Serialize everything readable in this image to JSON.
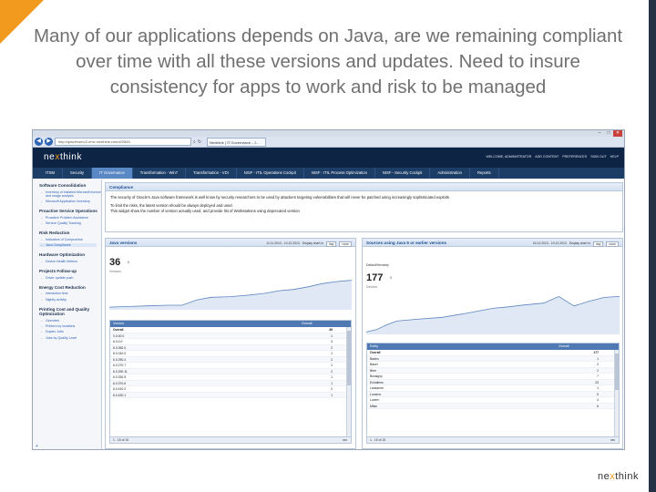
{
  "slide": {
    "title": "Many of our applications depends on Java, are we remaining compliant over time with all these versions and updates. Need to insure consistency for apps to work and risk to be managed",
    "brand_pre": "ne",
    "brand_x": "x",
    "brand_post": "think",
    "accent_color": "#f29a1d",
    "dark_color": "#253246"
  },
  "browser": {
    "url": "http://qaw.fixserv2.emc.nexthink.com/#/2845",
    "tab": "Nexthink | IT Governance - J...",
    "back_icon": "back-arrow-icon",
    "forward_icon": "forward-arrow-icon"
  },
  "app": {
    "logo_pre": "ne",
    "logo_x": "x",
    "logo_post": "think",
    "user_links": [
      "WELCOME, ADMINISTRATOR",
      "ADD CONTENT",
      "PREFERENCES",
      "SIGN OUT",
      "HELP"
    ],
    "tabs": [
      {
        "label": "ITSM",
        "active": false
      },
      {
        "label": "Security",
        "active": false
      },
      {
        "label": "IT Governance",
        "active": true
      },
      {
        "label": "Transformation - Win7",
        "active": false
      },
      {
        "label": "Transformation - VDI",
        "active": false
      },
      {
        "label": "NISF - ITIL Operations Cockpit",
        "active": false
      },
      {
        "label": "NISF - ITIL Process Optimization",
        "active": false
      },
      {
        "label": "NISF - Security Cockpit",
        "active": false
      },
      {
        "label": "Administration",
        "active": false
      },
      {
        "label": "Reports",
        "active": false
      }
    ]
  },
  "sidebar": {
    "groups": [
      {
        "title": "Software Consolidation",
        "items": [
          "Inventory of installed Microsoft licence and usage analysis",
          "Microsoft Application Inventory"
        ]
      },
      {
        "title": "Proactive Service Operations",
        "items": [
          "Proactive Problem Avoidance",
          "Service Quality Tracking"
        ]
      },
      {
        "title": "Risk Reduction",
        "items": [
          "Indicators of Compromise",
          "Java Compliance"
        ]
      },
      {
        "title": "Hardware Optimization",
        "items": [
          "Device Health Metrics"
        ]
      },
      {
        "title": "Projects Follow-up",
        "items": [
          "Driver update push"
        ]
      },
      {
        "title": "Energy Cost Reduction",
        "items": [
          "Interaction time",
          "Nightly activity"
        ]
      },
      {
        "title": "Printing Cost and Quality Optimization",
        "items": [
          "Overview",
          "Printers by locations",
          "Duplex Jobs",
          "Jobs by Quality Level"
        ]
      }
    ],
    "active_item": "Java Compliance",
    "add_label": "+"
  },
  "compliance": {
    "header": "Compliance",
    "lines": [
      "The security of Oracle's Java software framework is well know by security researchers to be used by attackers targeting vulnerabilities that will never be patched using increasingly sophisticated exploits",
      "To limit the risks, the latest version should be always deployed and used.",
      "This widget show the number of version actually used, and provide list of Workstations using deprecated version"
    ]
  },
  "java_versions": {
    "header": "Java versions",
    "date_range": "11.11.2013 - 10.12.2013",
    "display_label": "Display chart in",
    "display_value": "day",
    "compare_value": "none",
    "kpi_value": "36",
    "kpi_sub": "Versions",
    "kpi_delta": "0",
    "table_headers": [
      "Version",
      "Overall"
    ],
    "rows": [
      [
        "Overall",
        "36"
      ],
      [
        "0.0.00.0",
        "1"
      ],
      [
        "6.0.0.0",
        "3"
      ],
      [
        "6.0.260.0",
        "2"
      ],
      [
        "6.0.310.0",
        "1"
      ],
      [
        "6.0.290.4",
        "2"
      ],
      [
        "6.0.270.7",
        "1"
      ],
      [
        "6.0.290.11",
        "2"
      ],
      [
        "6.0.330.5",
        "1"
      ],
      [
        "6.0.370.6",
        "1"
      ],
      [
        "6.0.410.2",
        "2"
      ],
      [
        "6.0.430.1",
        "1"
      ]
    ],
    "pager": "1 - 15 of 15",
    "export_label": "csv"
  },
  "java6": {
    "header": "Sources using Java 6 or earlier versions",
    "date_range": "04.12.2013 - 10.12.2013",
    "display_label": "Display chart in",
    "display_value": "day",
    "compare_value": "none",
    "legend": "Default/Hexacity",
    "kpi_value": "177",
    "kpi_sub": "Devices",
    "kpi_delta": "0",
    "table_headers": [
      "Entity",
      "Overall"
    ],
    "rows": [
      [
        "Overall",
        "177"
      ],
      [
        "Baden",
        "1"
      ],
      [
        "Basel",
        "2"
      ],
      [
        "Bern",
        "2"
      ],
      [
        "Bussigny",
        "7"
      ],
      [
        "Echallens",
        "23"
      ],
      [
        "Lausanne",
        "1"
      ],
      [
        "Locarno",
        "5"
      ],
      [
        "Lucern",
        "4"
      ],
      [
        "Milan",
        "6"
      ]
    ],
    "pager": "1 - 15 of 15",
    "export_label": "csv"
  }
}
